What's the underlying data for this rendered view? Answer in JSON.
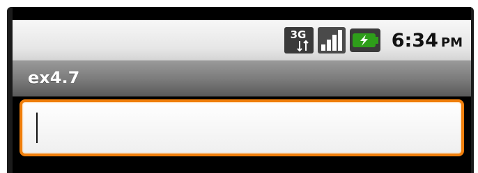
{
  "status_bar": {
    "network": "3G",
    "icons": [
      "network-3g-icon",
      "signal-strength-icon",
      "battery-charging-icon"
    ],
    "time": "6:34",
    "am_pm": "PM"
  },
  "title_bar": {
    "title": "ex4.7"
  },
  "edit_field": {
    "value": "",
    "has_focus": true
  },
  "colors": {
    "focus_border": "#f07f0c",
    "title_bar": "#7a7a7a",
    "battery": "#2e9e1a"
  }
}
